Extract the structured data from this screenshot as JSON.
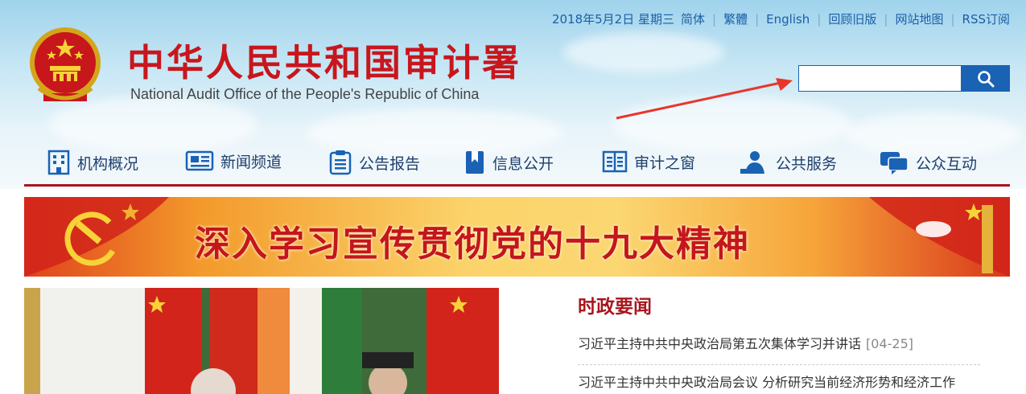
{
  "topbar": {
    "date": "2018年5月2日  星期三",
    "links": [
      "简体",
      "繁體",
      "English",
      "回顾旧版",
      "网站地图",
      "RSS订阅"
    ]
  },
  "header": {
    "title": "中华人民共和国审计署",
    "subtitle": "National Audit Office of the People's Republic of China"
  },
  "search": {
    "value": "",
    "placeholder": ""
  },
  "nav": {
    "items": [
      {
        "label": "机构概况",
        "icon": "building-icon"
      },
      {
        "label": "新闻频道",
        "icon": "newspaper-icon"
      },
      {
        "label": "公告报告",
        "icon": "clipboard-icon"
      },
      {
        "label": "信息公开",
        "icon": "bookmark-book-icon"
      },
      {
        "label": "审计之窗",
        "icon": "open-book-icon"
      },
      {
        "label": "公共服务",
        "icon": "person-desk-icon"
      },
      {
        "label": "公众互动",
        "icon": "chat-bubbles-icon"
      }
    ]
  },
  "banner": {
    "text": "深入学习宣传贯彻党的十九大精神"
  },
  "news": {
    "section_title": "时政要闻",
    "items": [
      {
        "title": "习近平主持中共中央政治局第五次集体学习并讲话",
        "date": "[04-25]"
      },
      {
        "title": "习近平主持中共中央政治局会议 分析研究当前经济形势和经济工作",
        "date": ""
      }
    ]
  },
  "colors": {
    "brand_red": "#c8161d",
    "nav_line": "#a9151c",
    "link_blue": "#1b5fa8",
    "search_blue": "#1a62b4"
  }
}
